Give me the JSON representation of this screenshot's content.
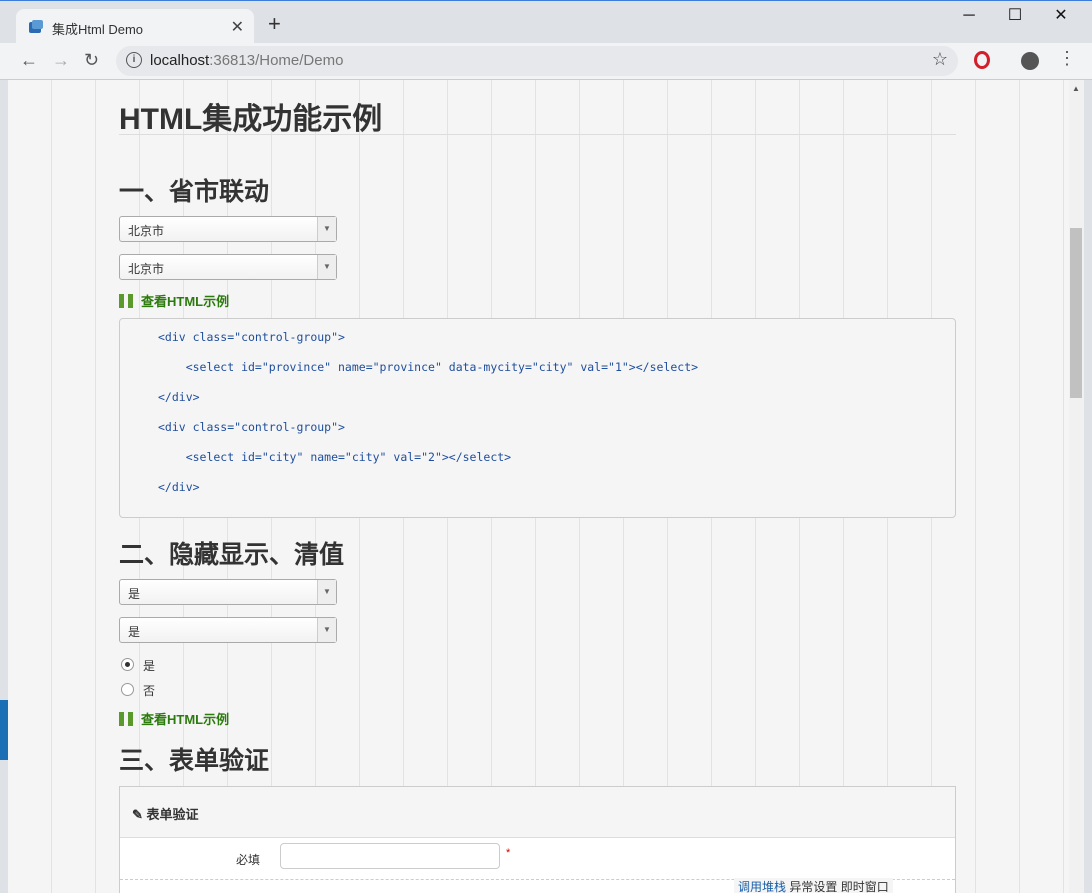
{
  "browser": {
    "tab_title": "集成Html Demo",
    "tab_close": "✕",
    "new_tab": "+",
    "window_controls": {
      "minimize": "─",
      "maximize": "☐",
      "close": "✕"
    },
    "nav": {
      "back": "←",
      "forward": "→",
      "reload": "↻"
    },
    "url_host": "localhost",
    "url_rest": ":36813/Home/Demo",
    "bookmark_star": "☆",
    "menu": "⋮"
  },
  "page": {
    "title": "HTML集成功能示例",
    "section1": {
      "heading": "一、省市联动",
      "province_select": "北京市",
      "city_select": "北京市",
      "view_html_link": "查看HTML示例",
      "code_lines": [
        "<div class=\"control-group\">",
        "    <select id=\"province\" name=\"province\" data-mycity=\"city\" val=\"1\"></select>",
        "</div>",
        "<div class=\"control-group\">",
        "    <select id=\"city\" name=\"city\" val=\"2\"></select>",
        "</div>"
      ]
    },
    "section2": {
      "heading": "二、隐藏显示、清值",
      "select1": "是",
      "select2": "是",
      "radio_yes": "是",
      "radio_no": "否",
      "radio_selected": "是",
      "view_html_link": "查看HTML示例"
    },
    "section3": {
      "heading": "三、表单验证",
      "panel_title": "表单验证",
      "required_label": "必填",
      "required_value": "",
      "required_mark": "*"
    }
  },
  "status_bar": {
    "item1": "调用堆栈",
    "item2": "异常设置",
    "item3": "即时窗口"
  }
}
